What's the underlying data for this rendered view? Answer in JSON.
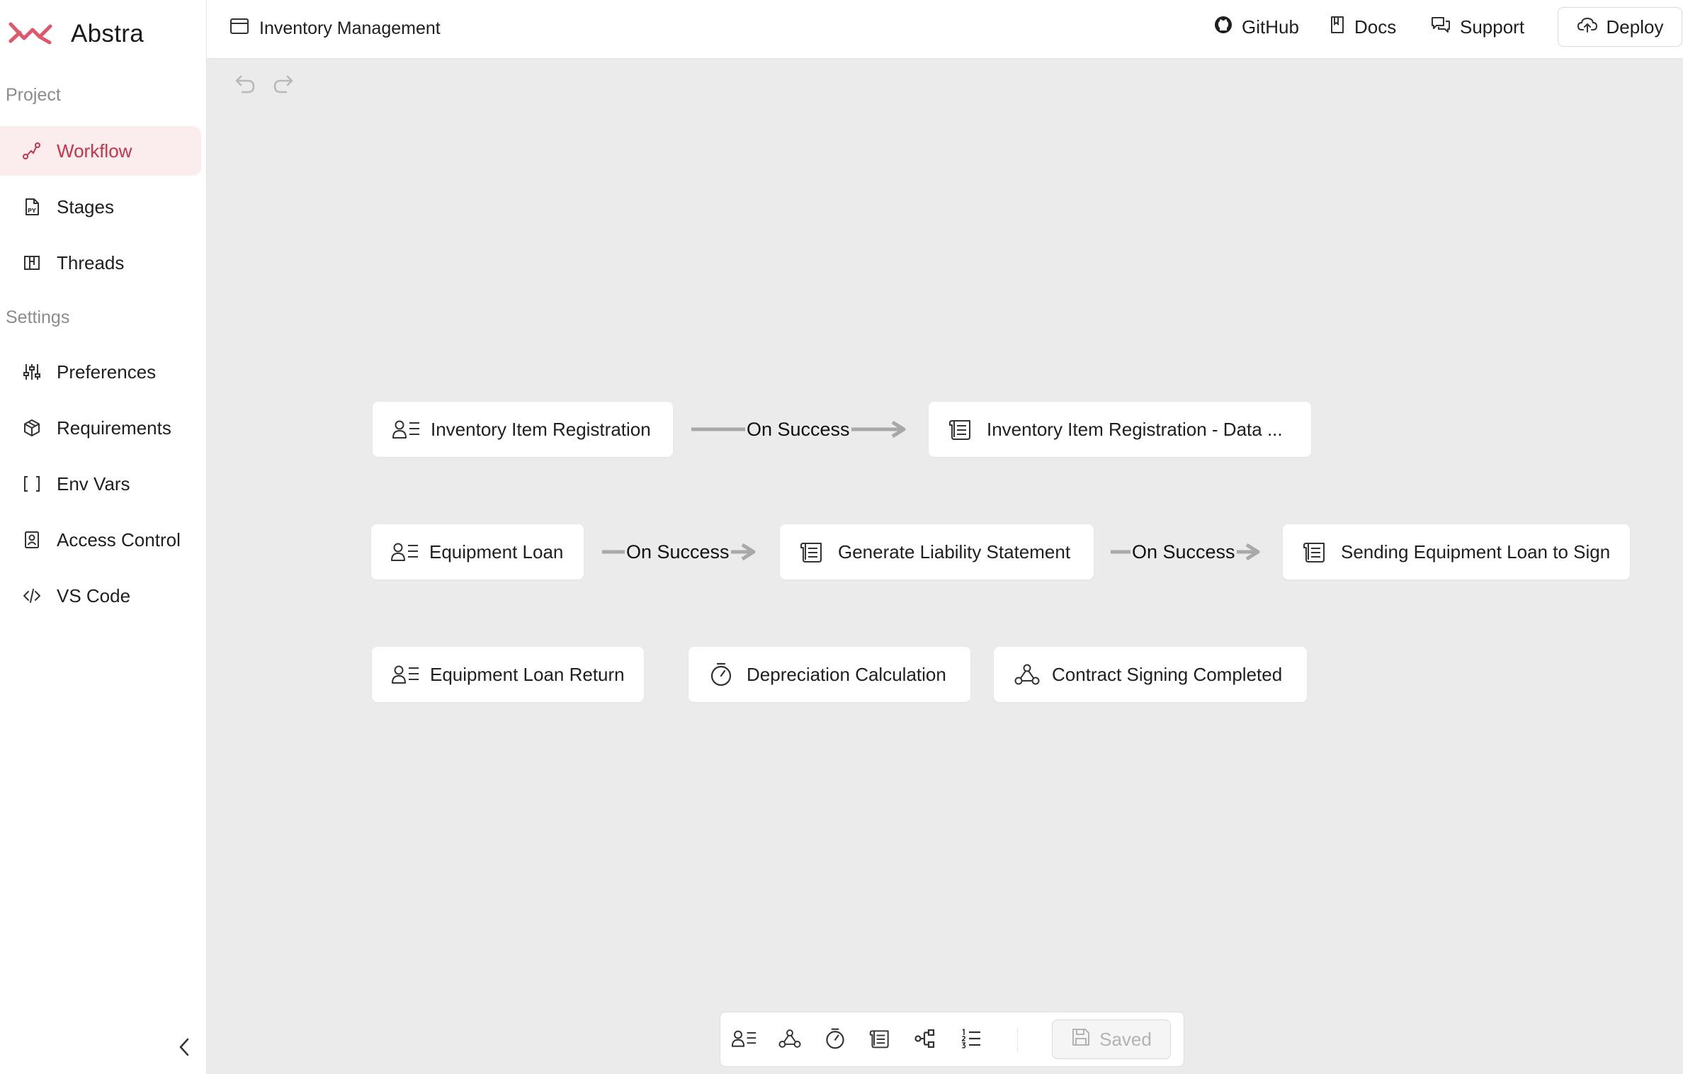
{
  "brand": {
    "name": "Abstra",
    "accent": "#e0566b"
  },
  "sidebar": {
    "project_label": "Project",
    "settings_label": "Settings",
    "project_items": [
      {
        "label": "Workflow",
        "icon": "workflow-icon",
        "active": true
      },
      {
        "label": "Stages",
        "icon": "python-file-icon"
      },
      {
        "label": "Threads",
        "icon": "kanban-icon"
      }
    ],
    "settings_items": [
      {
        "label": "Preferences",
        "icon": "sliders-icon"
      },
      {
        "label": "Requirements",
        "icon": "package-icon"
      },
      {
        "label": "Env Vars",
        "icon": "brackets-icon"
      },
      {
        "label": "Access Control",
        "icon": "id-badge-icon"
      },
      {
        "label": "VS Code",
        "icon": "code-icon"
      }
    ]
  },
  "header": {
    "project_title": "Inventory Management",
    "links": {
      "github": "GitHub",
      "docs": "Docs",
      "support": "Support"
    },
    "deploy_label": "Deploy"
  },
  "workflow": {
    "nodes": [
      {
        "label": "Inventory Item Registration",
        "type": "form"
      },
      {
        "label": "Inventory Item Registration - Data ...",
        "type": "script"
      },
      {
        "label": "Equipment Loan",
        "type": "form"
      },
      {
        "label": "Generate Liability Statement",
        "type": "script"
      },
      {
        "label": "Sending Equipment Loan to Sign",
        "type": "script"
      },
      {
        "label": "Equipment Loan Return",
        "type": "form"
      },
      {
        "label": "Depreciation Calculation",
        "type": "job"
      },
      {
        "label": "Contract Signing Completed",
        "type": "hook"
      }
    ],
    "edges": [
      {
        "label": "On Success"
      },
      {
        "label": "On Success"
      },
      {
        "label": "On Success"
      }
    ]
  },
  "toolbar": {
    "tools": [
      "form-icon",
      "hook-icon",
      "job-icon",
      "script-icon",
      "condition-icon",
      "iterator-icon"
    ],
    "saved_label": "Saved"
  }
}
